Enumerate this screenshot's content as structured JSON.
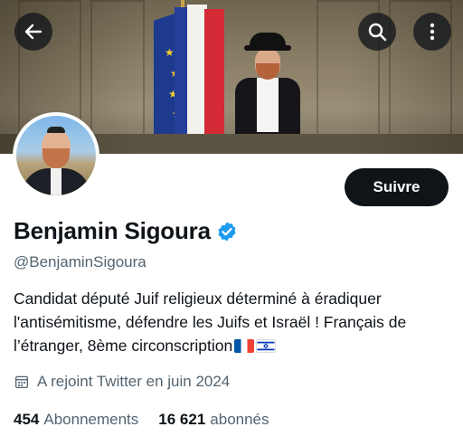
{
  "header": {
    "back_icon": "arrow-left-icon",
    "search_icon": "search-icon",
    "more_icon": "more-vertical-icon"
  },
  "profile": {
    "name": "Benjamin Sigoura",
    "handle": "@BenjaminSigoura",
    "verified": true,
    "follow_label": "Suivre",
    "bio_text": "Candidat député Juif religieux déterminé à éradiquer l'antisémitisme, défendre les Juifs et Israël ! Français de l’étranger, 8ème circonscription",
    "bio_flags": [
      "flag-france-icon",
      "flag-israel-icon"
    ],
    "joined": "A rejoint Twitter en juin 2024",
    "stats": {
      "following_count": "454",
      "following_label": "Abonnements",
      "followers_count": "16 621",
      "followers_label": "abonnés"
    }
  },
  "colors": {
    "primary_text": "#0f1419",
    "secondary_text": "#536471",
    "verified_blue": "#1d9bf0",
    "button_bg": "#0f1419"
  }
}
